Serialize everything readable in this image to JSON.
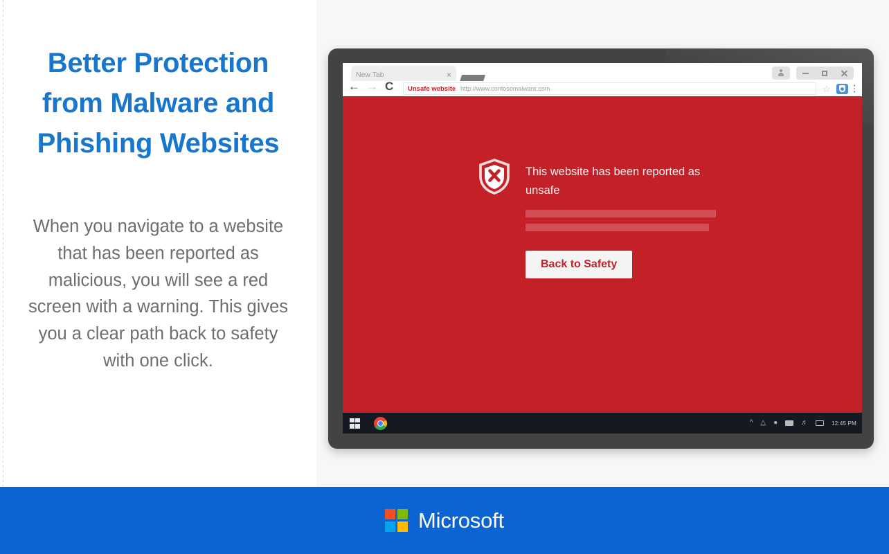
{
  "slide": {
    "title": "Better Protection from Malware and Phishing Websites",
    "paragraph": "When you navigate to a website that has been reported as malicious, you will see a red screen with a warning.  This gives you a clear path back to safety with one click."
  },
  "browser": {
    "tab": {
      "title": "New Tab",
      "close_label": "×",
      "new_tab_label": ""
    },
    "nav": {
      "back_label": "",
      "forward_label": "",
      "reload_label": ""
    },
    "omnibox": {
      "security_label": "Unsafe website",
      "url": "http://www.contosomalware.com",
      "bookmark_label": "☆"
    },
    "window_controls": {
      "avatar_label": "",
      "minimize_label": "",
      "maximize_label": "",
      "close_label": ""
    }
  },
  "warning": {
    "heading": "This website has been reported as unsafe",
    "button_label": "Back to Safety",
    "background_color": "#C32028",
    "placeholder_bar_color": "#D15057"
  },
  "taskbar": {
    "start_label": "",
    "chrome_label": "",
    "clock": "12:45 PM"
  },
  "footer": {
    "brand": "Microsoft",
    "background_color": "#0C63D2"
  },
  "theme": {
    "title_color": "#1877CC",
    "paragraph_color": "#6E6E6E",
    "panel_background": "#F7F7F7",
    "bezel_color": "#434343"
  }
}
